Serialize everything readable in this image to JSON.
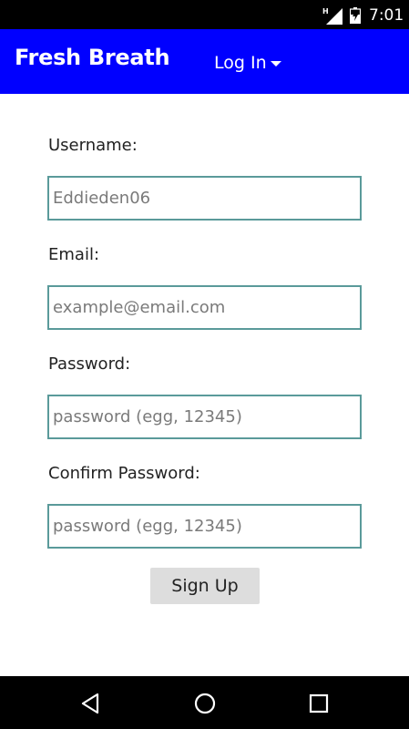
{
  "status_bar": {
    "network_label": "H",
    "time": "7:01"
  },
  "header": {
    "app_title": "Fresh Breath",
    "login_menu_label": "Log In"
  },
  "form": {
    "username": {
      "label": "Username:",
      "value": "",
      "placeholder": "Eddieden06"
    },
    "email": {
      "label": "Email:",
      "value": "",
      "placeholder": "example@email.com"
    },
    "password": {
      "label": "Password:",
      "value": "",
      "placeholder": "password (egg, 12345)"
    },
    "confirm_password": {
      "label": "Confirm Password:",
      "value": "",
      "placeholder": "password (egg, 12345)"
    },
    "submit_label": "Sign Up"
  },
  "colors": {
    "header_bg": "#0000ff",
    "input_border": "#5a9a9a",
    "button_bg": "#dddddd",
    "system_bars": "#000000"
  },
  "icons": {
    "status": [
      "signal-icon",
      "battery-charging-icon"
    ],
    "navigation": [
      "back-icon",
      "home-icon",
      "recents-icon"
    ]
  }
}
